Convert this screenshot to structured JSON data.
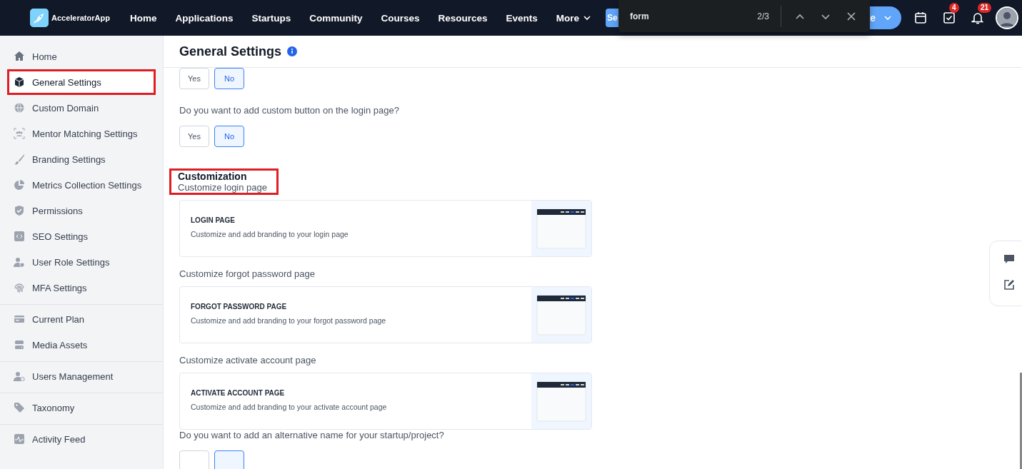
{
  "topbar": {
    "brand": "AcceleratorApp",
    "nav": [
      "Home",
      "Applications",
      "Startups",
      "Community",
      "Courses",
      "Resources",
      "Events"
    ],
    "more": "More",
    "left_button": "Se",
    "right_button": "e",
    "tasks_badge": "4",
    "notifications_badge": "21"
  },
  "find_bar": {
    "value": "form",
    "count": "2/3"
  },
  "sidebar": {
    "groups": [
      [
        {
          "label": "Home",
          "selected": false,
          "annotated": false
        },
        {
          "label": "General Settings",
          "selected": true,
          "annotated": true
        },
        {
          "label": "Custom Domain",
          "selected": false,
          "annotated": false
        },
        {
          "label": "Mentor Matching Settings",
          "selected": false,
          "annotated": false
        },
        {
          "label": "Branding Settings",
          "selected": false,
          "annotated": false
        },
        {
          "label": "Metrics Collection Settings",
          "selected": false,
          "annotated": false
        },
        {
          "label": "Permissions",
          "selected": false,
          "annotated": false
        },
        {
          "label": "SEO Settings",
          "selected": false,
          "annotated": false
        },
        {
          "label": "User Role Settings",
          "selected": false,
          "annotated": false
        },
        {
          "label": "MFA Settings",
          "selected": false,
          "annotated": false
        }
      ],
      [
        {
          "label": "Current Plan",
          "selected": false,
          "annotated": false
        },
        {
          "label": "Media Assets",
          "selected": false,
          "annotated": false
        }
      ],
      [
        {
          "label": "Users Management",
          "selected": false,
          "annotated": false
        }
      ],
      [
        {
          "label": "Taxonomy",
          "selected": false,
          "annotated": false
        }
      ],
      [
        {
          "label": "Activity Feed",
          "selected": false,
          "annotated": false
        }
      ]
    ]
  },
  "page": {
    "title": "General Settings"
  },
  "content": [
    {
      "kind": "choice",
      "options": [
        {
          "label": "Yes",
          "selected": false
        },
        {
          "label": "No",
          "selected": true
        }
      ]
    },
    {
      "kind": "question",
      "text": "Do you want to add custom button on the login page?",
      "options": [
        {
          "label": "Yes",
          "selected": false
        },
        {
          "label": "No",
          "selected": true
        }
      ]
    },
    {
      "kind": "section",
      "title": "Customization",
      "subtitle": "Customize login page",
      "annotated": true,
      "card": {
        "title": "LOGIN PAGE",
        "description": "Customize and add branding to your login page"
      }
    },
    {
      "kind": "subsection",
      "subtitle": "Customize forgot password page",
      "card": {
        "title": "FORGOT PASSWORD PAGE",
        "description": "Customize and add branding to your forgot password page"
      }
    },
    {
      "kind": "subsection",
      "subtitle": "Customize activate account page",
      "card": {
        "title": "ACTIVATE ACCOUNT PAGE",
        "description": "Customize and add branding to your activate account page"
      }
    },
    {
      "kind": "question",
      "text": "Do you want to add an alternative name for your startup/project?",
      "options": [
        {
          "selected": false
        },
        {
          "selected": true
        }
      ]
    }
  ]
}
